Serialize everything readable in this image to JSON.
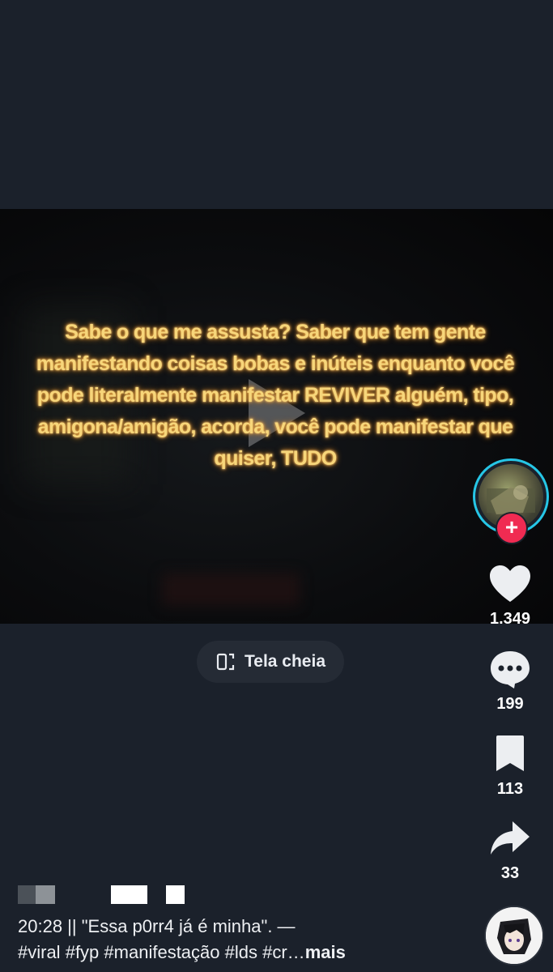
{
  "video": {
    "caption": "Sabe o que me assusta? Saber que tem gente manifestando coisas bobas e inúteis enquanto você pode literalmente manifestar REVIVER alguém, tipo, amigona/amigão, acorda, você pode manifestar que quiser, TUDO"
  },
  "fullscreen": {
    "label": "Tela cheia",
    "icon": "fullscreen-icon"
  },
  "actions": {
    "likes": "1.349",
    "comments": "199",
    "saves": "113",
    "shares": "33"
  },
  "description": {
    "line1": "20:28 || \"Essa p0rr4 já é minha\". —",
    "hashtags": [
      "#viral",
      "#fyp",
      "#manifestação",
      "#lds",
      "#cr…"
    ],
    "more_label": "mais"
  },
  "colors": {
    "background": "#1b212b",
    "caption_text": "#f7d67a",
    "follow_accent": "#f02b52",
    "avatar_ring": "#26c6e6"
  }
}
